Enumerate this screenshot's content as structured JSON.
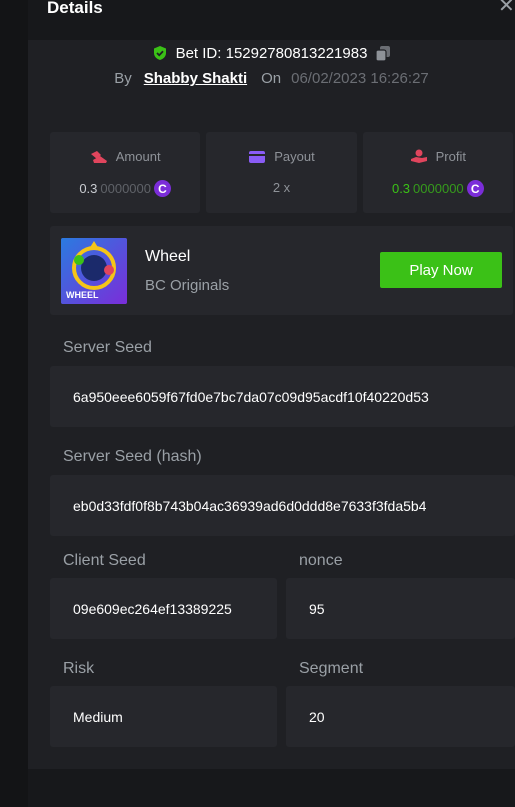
{
  "modal": {
    "title": "Details",
    "close_glyph": "✕"
  },
  "bet": {
    "id_label": "Bet ID: 1529278081322198​3",
    "by_label": "By",
    "user": "Shabby Shakti",
    "on_label": "On",
    "date": "06/02/2023 16:26:27"
  },
  "stats": [
    {
      "label": "Amount",
      "value_main": "0.3",
      "value_rest": "0000000",
      "icon": "coin-bag-icon",
      "icon_color": "#e0455d"
    },
    {
      "label": "Payout",
      "value_main": "2 x",
      "value_rest": "",
      "icon": "card-icon",
      "icon_color": "#8a5cf5"
    },
    {
      "label": "Profit",
      "value_main": "0.3",
      "value_rest": "0000000",
      "icon": "hand-coin-icon",
      "icon_color": "#e0455d"
    }
  ],
  "currency_symbol": "C",
  "game": {
    "thumbnail_text": "WHEEL",
    "name": "Wheel",
    "provider": "BC Originals",
    "play_label": "Play Now"
  },
  "fields": {
    "server_seed": {
      "label": "Server Seed",
      "value": "6a950eee6059f67fd0e7bc7da07c09d95acdf10f40220d53"
    },
    "server_seed_hash": {
      "label": "Server Seed (hash)",
      "value": "eb0d33fdf0f8b743b04ac36939ad6d0ddd8e7633f3fda5b4"
    },
    "client_seed": {
      "label": "Client Seed",
      "value": "09e609ec264ef13389225"
    },
    "nonce": {
      "label": "nonce",
      "value": "95"
    },
    "risk": {
      "label": "Risk",
      "value": "Medium"
    },
    "segment": {
      "label": "Segment",
      "value": "20"
    }
  },
  "colors": {
    "accent_green": "#3bc117",
    "background": "#1f2024",
    "card": "#26272c"
  }
}
